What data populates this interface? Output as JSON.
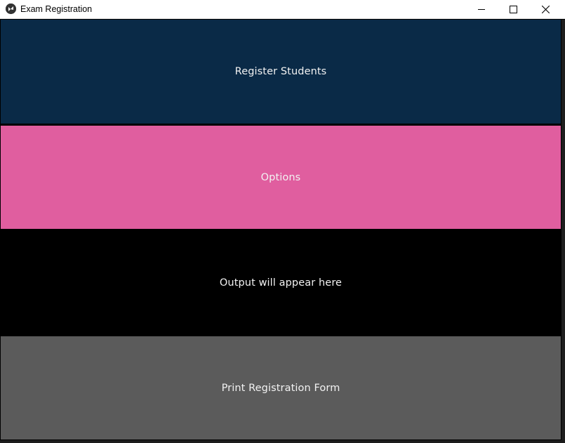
{
  "window": {
    "title": "Exam Registration",
    "icon": "kivy-app-icon",
    "controls": {
      "minimize": "minimize-icon",
      "maximize": "maximize-icon",
      "close": "close-icon"
    }
  },
  "main": {
    "register_label": "Register Students",
    "options_label": "Options",
    "output_text": "Output will appear here",
    "print_label": "Print Registration Form"
  },
  "colors": {
    "register_bg": "#0a2a47",
    "options_bg": "#e05e9f",
    "output_bg": "#000000",
    "print_bg": "#5b5b5b",
    "text": "#f2f2f2"
  }
}
